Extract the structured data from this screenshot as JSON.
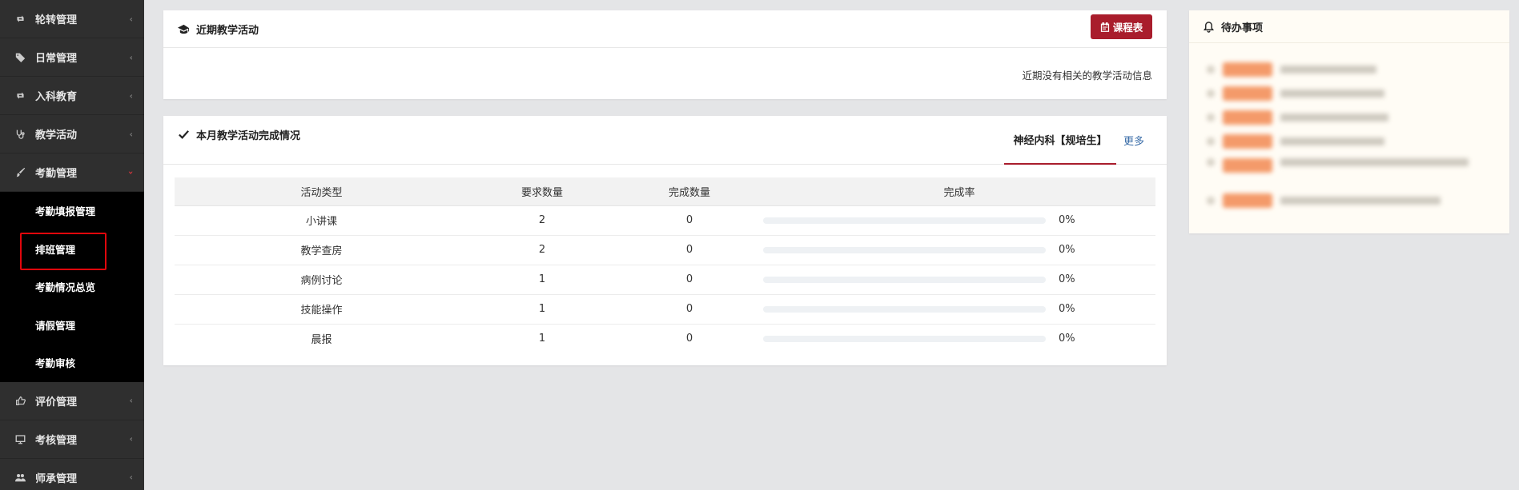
{
  "sidebar": {
    "items": [
      {
        "label": "轮转管理",
        "icon": "retweet-icon"
      },
      {
        "label": "日常管理",
        "icon": "tag-icon"
      },
      {
        "label": "入科教育",
        "icon": "retweet-icon"
      },
      {
        "label": "教学活动",
        "icon": "stethoscope-icon"
      },
      {
        "label": "考勤管理",
        "icon": "brush-icon",
        "open": true
      },
      {
        "label": "评价管理",
        "icon": "thumbs-up-icon"
      },
      {
        "label": "考核管理",
        "icon": "monitor-icon"
      },
      {
        "label": "师承管理",
        "icon": "users-icon"
      }
    ],
    "submenu": [
      {
        "label": "考勤填报管理"
      },
      {
        "label": "排班管理",
        "highlighted": true
      },
      {
        "label": "考勤情况总览"
      },
      {
        "label": "请假管理"
      },
      {
        "label": "考勤审核"
      }
    ],
    "chevron": "‹",
    "chevron_open": "›"
  },
  "recent_activities": {
    "title": "近期教学活动",
    "schedule_button": "课程表",
    "empty_message": "近期没有相关的教学活动信息"
  },
  "monthly_completion": {
    "title": "本月教学活动完成情况",
    "active_tab": "神经内科【规培生】",
    "more_link": "更多",
    "columns": [
      "活动类型",
      "要求数量",
      "完成数量",
      "完成率"
    ],
    "rows": [
      {
        "type": "小讲课",
        "required": "2",
        "completed": "0",
        "rate": "0%",
        "progress": 0
      },
      {
        "type": "教学查房",
        "required": "2",
        "completed": "0",
        "rate": "0%",
        "progress": 0
      },
      {
        "type": "病例讨论",
        "required": "1",
        "completed": "0",
        "rate": "0%",
        "progress": 0
      },
      {
        "type": "技能操作",
        "required": "1",
        "completed": "0",
        "rate": "0%",
        "progress": 0
      },
      {
        "type": "晨报",
        "required": "1",
        "completed": "0",
        "rate": "0%",
        "progress": 0
      }
    ]
  },
  "todo": {
    "title": "待办事项"
  },
  "colors": {
    "sidebar_bg": "#2f2f2f",
    "submenu_bg": "#000000",
    "accent": "#a91d2c",
    "highlight_border": "#e0060c",
    "link": "#3a6da8",
    "todo_bg": "#fffcf5",
    "badge": "#f49a6a"
  }
}
